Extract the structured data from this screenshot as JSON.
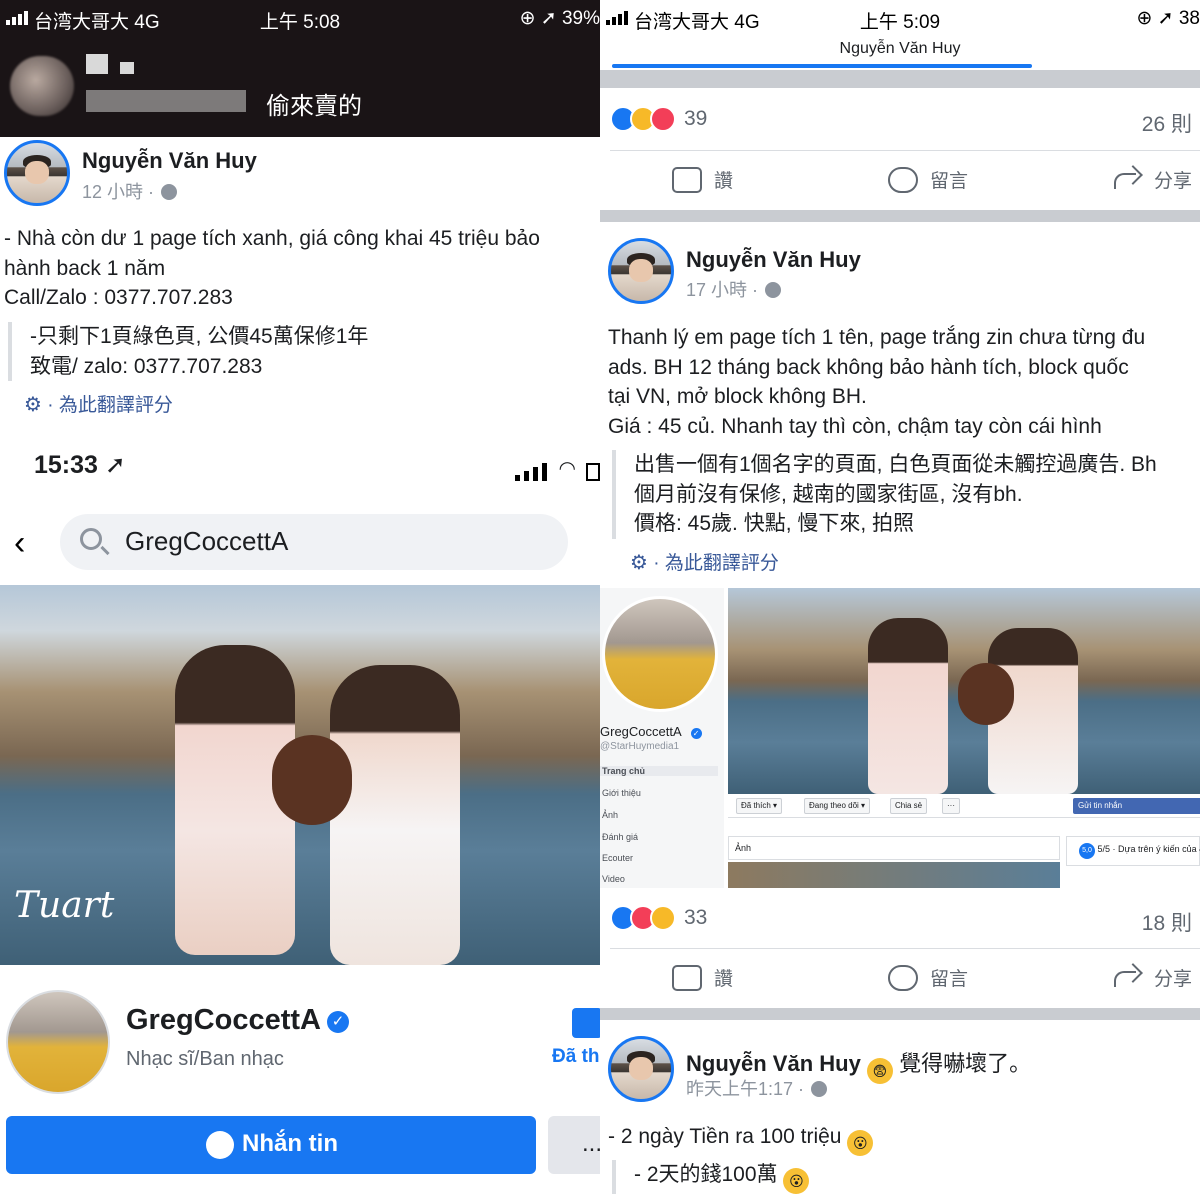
{
  "left_top": {
    "status": {
      "carrier": "台湾大哥大  4G",
      "time": "上午 5:08",
      "right": "⊕ ➚ 39%"
    },
    "redacted_title": "偷來賣的",
    "post": {
      "author": "Nguyễn Văn Huy",
      "meta": "12 小時 ·",
      "body": [
        "- Nhà còn dư 1 page tích xanh, giá công khai 45 triệu bảo",
        "hành back 1 năm",
        "Call/Zalo : 0377.707.283"
      ],
      "translation": [
        "-只剩下1頁綠色頁, 公價45萬保修1年",
        "致電/ zalo: 0377.707.283"
      ],
      "rate_translation": "為此翻譯評分"
    }
  },
  "left_bottom": {
    "time": "15:33",
    "search_query": "GregCoccettA",
    "cover_watermark": "Tuart",
    "page": {
      "name": "GregCoccettA",
      "category": "Nhạc sĩ/Ban nhạc",
      "liked_label": "Đã th"
    },
    "message_button": "Nhắn tin",
    "more_button": "..."
  },
  "right": {
    "status": {
      "carrier": "台湾大哥大  4G",
      "time": "上午 5:09",
      "right": "⊕ ➚ 38"
    },
    "page_title": "Nguyễn Văn Huy",
    "post1_stats": {
      "reactions": "39",
      "comments": "26 則"
    },
    "actions": {
      "like": "讚",
      "comment": "留言",
      "share": "分享"
    },
    "post2": {
      "author": "Nguyễn Văn Huy",
      "meta": "17 小時 ·",
      "body": [
        "Thanh lý em page tích 1 tên, page trắng zin chưa từng đu",
        "ads. BH 12 tháng back không bảo hành tích, block quốc",
        "tại VN, mở block không BH.",
        "Giá : 45 củ. Nhanh tay thì còn, chậm tay còn cái hình"
      ],
      "translation": [
        "出售一個有1個名字的頁面, 白色頁面從未觸控過廣告. Bh",
        "個月前沒有保修, 越南的國家街區, 沒有bh.",
        "價格: 45歲. 快點, 慢下來, 拍照"
      ],
      "rate_translation": "為此翻譯評分",
      "embed": {
        "name": "GregCoccettA",
        "handle": "@StarHuymedia1",
        "nav": [
          "Trang chủ",
          "Giới thiệu",
          "Ảnh",
          "Đánh giá",
          "Ecouter",
          "Video"
        ],
        "buttons": [
          "Đã thích ▾",
          "Đang theo dõi ▾",
          "Chia sẻ",
          "···"
        ],
        "send_message": "Gửi tin nhắn",
        "photos_label": "Ảnh",
        "rating_badge": "5,0",
        "rating_text": "5/5 · Dựa trên ý kiến của 4"
      }
    },
    "post2_stats": {
      "reactions": "33",
      "comments": "18 則"
    },
    "post3": {
      "author": "Nguyễn Văn Huy",
      "feeling": "覺得嚇壞了。",
      "meta": "昨天上午1:17 ·",
      "body": "- 2 ngày Tiền ra 100 triệu",
      "translation": "- 2天的錢100萬"
    }
  }
}
